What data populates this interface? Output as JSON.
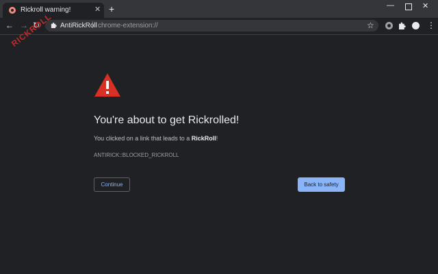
{
  "tab": {
    "title": "Rickroll warning!",
    "close_glyph": "✕",
    "favicon": "rickroll-shield-icon"
  },
  "new_tab_glyph": "+",
  "window_controls": {
    "minimize": "—",
    "close": "✕"
  },
  "toolbar": {
    "back_glyph": "←",
    "forward_glyph": "→",
    "reload_glyph": "↻",
    "site_label": "AntiRickRoll",
    "separator": "|",
    "url": "chrome-extension://",
    "star_glyph": "☆",
    "menu_glyph": "⋮"
  },
  "watermark": "RICKROLL",
  "warning": {
    "headline": "You're about to get Rickrolled!",
    "desc_prefix": "You clicked on a link that leads to a ",
    "desc_bold": "RickRoll",
    "desc_suffix": "!",
    "error_code": "ANTIRICK::BLOCKED_RICKROLL"
  },
  "buttons": {
    "continue": "Continue",
    "back_to_safety": "Back to safety"
  },
  "colors": {
    "background": "#202124",
    "accent": "#8ab4f8",
    "warning_red": "#d93025",
    "watermark_red": "#c62828"
  }
}
